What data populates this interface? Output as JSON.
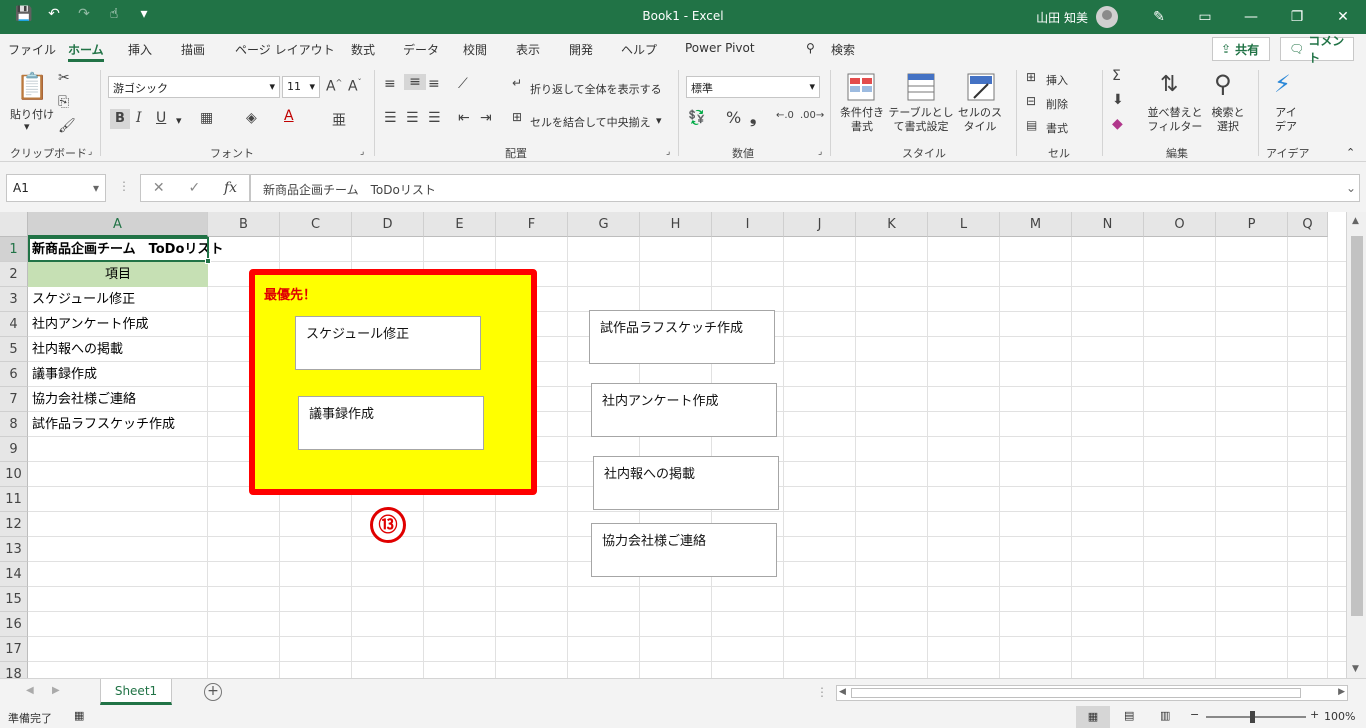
{
  "window": {
    "title": "Book1  -  Excel",
    "user": "山田 知美"
  },
  "menu": {
    "tabs": [
      "ファイル",
      "ホーム",
      "挿入",
      "描画",
      "ページ レイアウト",
      "数式",
      "データ",
      "校閲",
      "表示",
      "開発",
      "ヘルプ",
      "Power Pivot"
    ],
    "active": "ホーム",
    "search": "検索",
    "share": "共有",
    "comment": "コメント"
  },
  "ribbon": {
    "clipboard": {
      "paste": "貼り付け",
      "label": "クリップボード"
    },
    "font": {
      "name": "游ゴシック",
      "size": "11",
      "label": "フォント"
    },
    "alignment": {
      "wrap": "折り返して全体を表示する",
      "merge": "セルを結合して中央揃え",
      "label": "配置"
    },
    "number": {
      "format": "標準",
      "label": "数値"
    },
    "styles": {
      "conditional": "条件付き書式",
      "table": "テーブルとして書式設定",
      "cell": "セルのスタイル",
      "label": "スタイル"
    },
    "cells": {
      "insert": "挿入",
      "delete": "削除",
      "format": "書式",
      "label": "セル"
    },
    "editing": {
      "sort": "並べ替えとフィルター",
      "find": "検索と選択",
      "label": "編集"
    },
    "ideas": {
      "btn": "アイデア",
      "label": "アイデア"
    }
  },
  "formula": {
    "namebox": "A1",
    "fx": "fx",
    "content": "新商品企画チーム　ToDoリスト"
  },
  "columns": [
    "A",
    "B",
    "C",
    "D",
    "E",
    "F",
    "G",
    "H",
    "I",
    "J",
    "K",
    "L",
    "M",
    "N",
    "O",
    "P",
    "Q"
  ],
  "rows": [
    "1",
    "2",
    "3",
    "4",
    "5",
    "6",
    "7",
    "8",
    "9",
    "10",
    "11",
    "12",
    "13",
    "14",
    "15",
    "16",
    "17",
    "18"
  ],
  "cells": {
    "a1": "新商品企画チーム　ToDoリスト",
    "a2": "項目",
    "a3": "スケジュール修正",
    "a4": "社内アンケート作成",
    "a5": "社内報への掲載",
    "a6": "議事録作成",
    "a7": "協力会社様ご連絡",
    "a8": "試作品ラフスケッチ作成"
  },
  "shapes": {
    "priority_label": "最優先！",
    "priority_items": [
      "スケジュール修正",
      "議事録作成"
    ],
    "other_items": [
      "試作品ラフスケッチ作成",
      "社内アンケート作成",
      "社内報への掲載",
      "協力会社様ご連絡"
    ],
    "step_marker": "⑬"
  },
  "sheets": {
    "active": "Sheet1"
  },
  "status": {
    "ready": "準備完了",
    "zoom": "100%"
  },
  "colors": {
    "excel_green": "#217346",
    "header_fill": "#c6e0b4",
    "priority_fill": "#ffff00",
    "priority_border": "#ff0000"
  }
}
